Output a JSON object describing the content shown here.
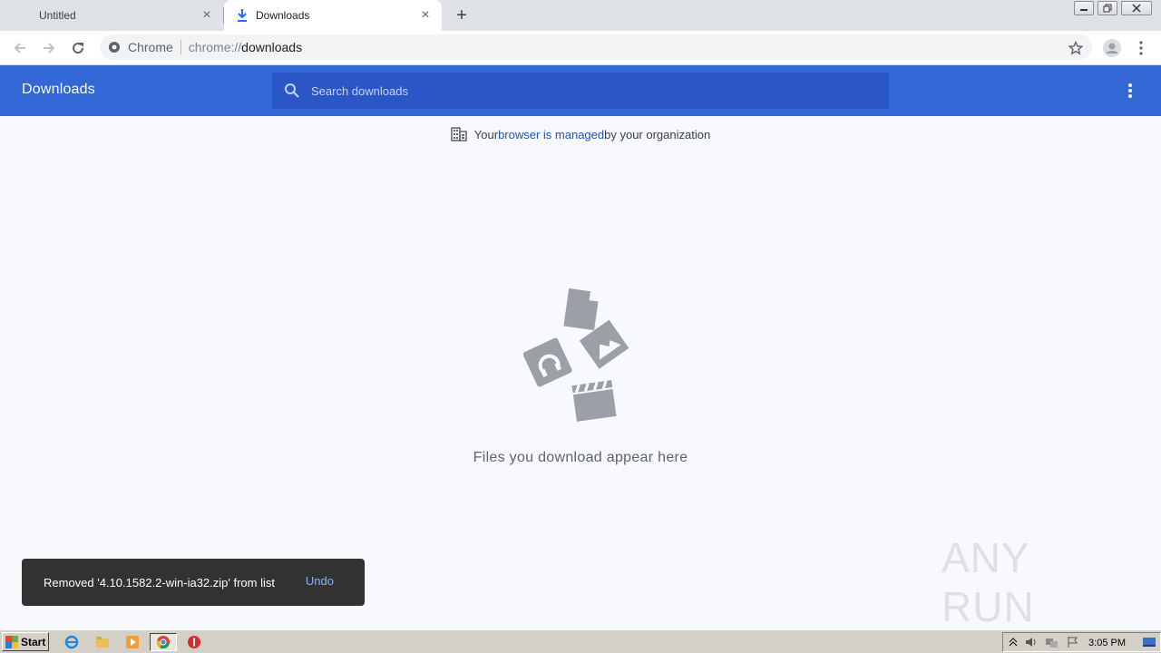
{
  "tabs": [
    {
      "label": "Untitled",
      "active": false
    },
    {
      "label": "Downloads",
      "active": true
    }
  ],
  "omnibox": {
    "site": "Chrome",
    "scheme": "chrome://",
    "host": "downloads"
  },
  "downloads": {
    "title": "Downloads",
    "search_placeholder": "Search downloads",
    "managed_prefix": "Your ",
    "managed_link": "browser is managed",
    "managed_suffix": " by your organization",
    "empty_text": "Files you download appear here"
  },
  "toast": {
    "message": "Removed '4.10.1582.2-win-ia32.zip' from list",
    "undo_label": "Undo"
  },
  "watermark": {
    "text": "ANY RUN"
  },
  "taskbar": {
    "start_label": "Start",
    "clock": "3:05 PM"
  },
  "colors": {
    "header_blue": "#3367d6",
    "search_blue": "#2a56c6",
    "link_blue": "#1a55b8",
    "toast_bg": "#323232",
    "undo_blue": "#8ab4f8",
    "page_bg": "#f7f9fc"
  },
  "icons": [
    "download-icon",
    "close-icon",
    "plus-icon",
    "back-icon",
    "forward-icon",
    "reload-icon",
    "chrome-icon",
    "star-icon",
    "profile-icon",
    "menu-icon",
    "search-icon",
    "building-icon",
    "files-illustration",
    "ie-icon",
    "explorer-icon",
    "media-icon",
    "chrome-taskbar-icon",
    "stop-icon"
  ]
}
